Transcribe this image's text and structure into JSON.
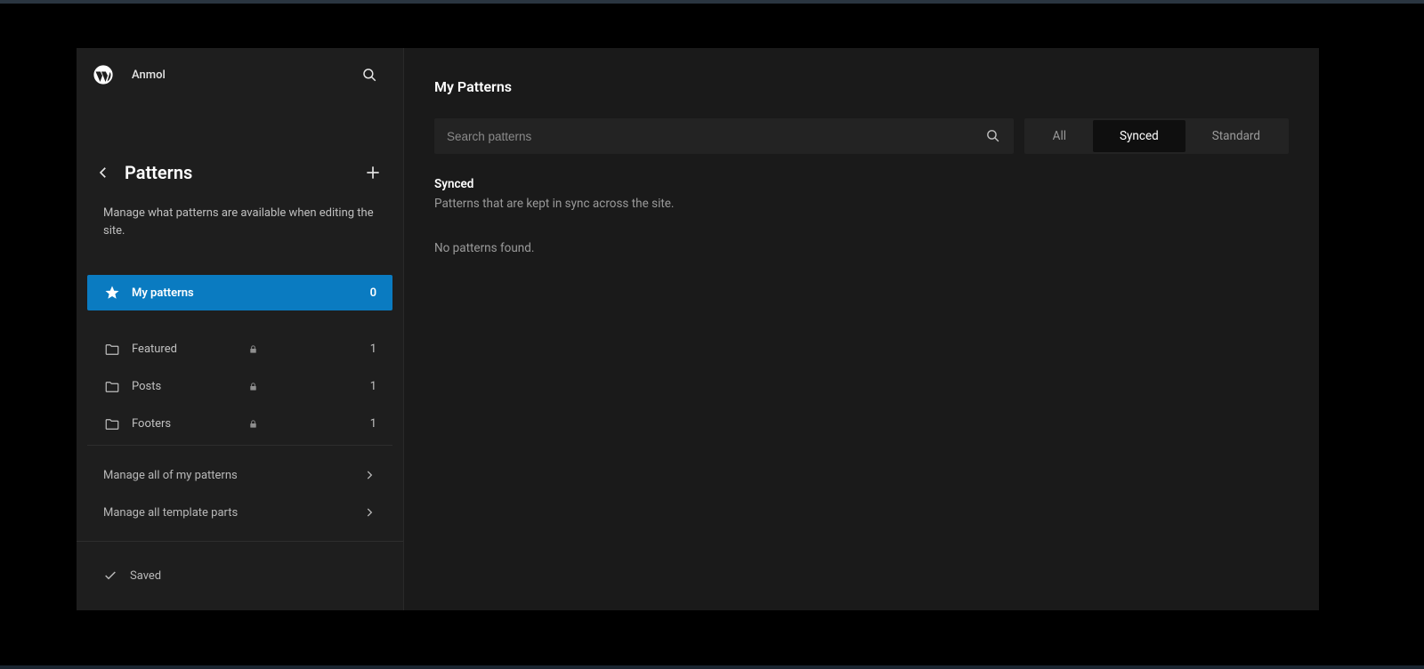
{
  "header": {
    "site_name": "Anmol"
  },
  "sidebar": {
    "title": "Patterns",
    "description": "Manage what patterns are available when editing the site.",
    "my_patterns": {
      "label": "My patterns",
      "count": "0"
    },
    "folders": [
      {
        "label": "Featured",
        "count": "1"
      },
      {
        "label": "Posts",
        "count": "1"
      },
      {
        "label": "Footers",
        "count": "1"
      }
    ],
    "manage": [
      {
        "label": "Manage all of my patterns"
      },
      {
        "label": "Manage all template parts"
      }
    ],
    "saved_label": "Saved"
  },
  "main": {
    "title": "My Patterns",
    "search_placeholder": "Search patterns",
    "filters": {
      "all": "All",
      "synced": "Synced",
      "standard": "Standard"
    },
    "section": {
      "heading": "Synced",
      "sub": "Patterns that are kept in sync across the site."
    },
    "empty": "No patterns found."
  }
}
